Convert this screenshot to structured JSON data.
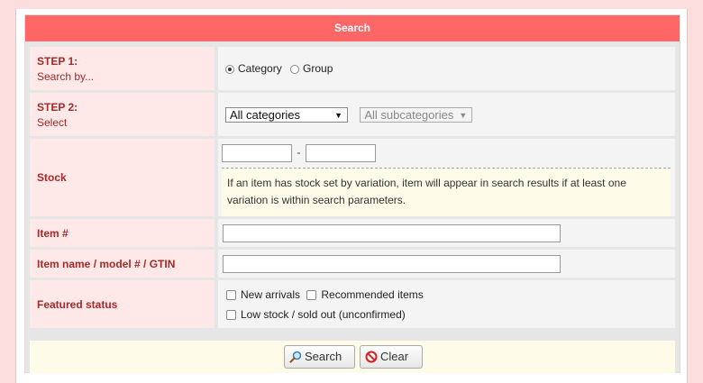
{
  "header": {
    "title": "Search"
  },
  "rows": {
    "step1": {
      "label": "STEP 1:",
      "sub": "Search by...",
      "options": [
        {
          "label": "Category",
          "selected": true
        },
        {
          "label": "Group",
          "selected": false
        }
      ]
    },
    "step2": {
      "label": "STEP 2:",
      "sub": "Select",
      "category_select": "All categories",
      "subcategory_select": "All subcategories"
    },
    "stock": {
      "label": "Stock",
      "min_value": "",
      "max_value": "",
      "separator": "-",
      "note": "If an item has stock set by variation, item will appear in search results if at least one variation is within search parameters."
    },
    "item_no": {
      "label": "Item #",
      "value": ""
    },
    "item_name": {
      "label": "Item name / model # / GTIN",
      "value": ""
    },
    "featured": {
      "label": "Featured status",
      "checkboxes": [
        "New arrivals",
        "Recommended items",
        "Low stock / sold out (unconfirmed)"
      ]
    }
  },
  "buttons": {
    "search": "Search",
    "clear": "Clear"
  },
  "icons": {
    "search": "magnifier-icon",
    "clear": "no-entry-icon"
  },
  "colors": {
    "header": "#ff6666",
    "label_bg": "#ffe8e8",
    "label_text": "#a52a2a",
    "note_bg": "#fefce8"
  }
}
